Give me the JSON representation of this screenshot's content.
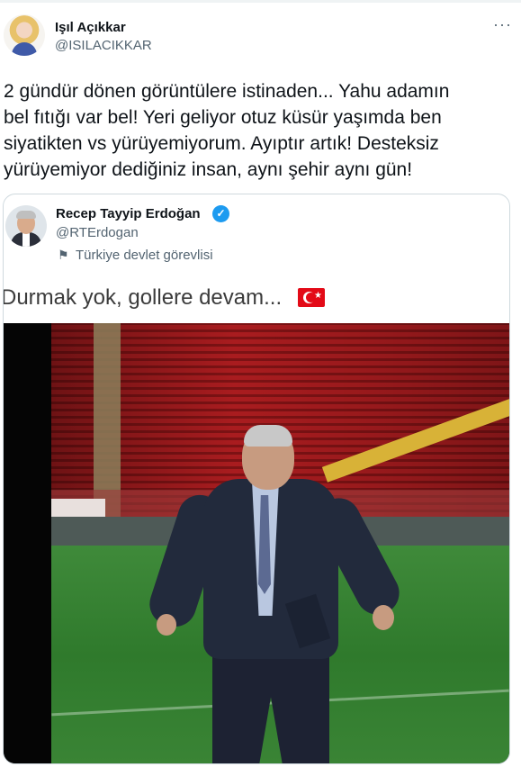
{
  "tweet": {
    "author": {
      "name": "Işıl Açıkkar",
      "handle": "@ISILACIKKAR",
      "avatar_icon": "profile-photo"
    },
    "more_icon": "more-options-icon",
    "more_label": "···",
    "text_lines": [
      "2 gündür dönen görüntülere istinaden... Yahu adamın",
      "bel fıtığı var bel! Yeri geliyor otuz küsür yaşımda ben",
      "siyatikten vs yürüyemiyorum. Ayıptır artık! Desteksiz",
      "yürüyemiyor dediğiniz insan, aynı şehir aynı gün!"
    ]
  },
  "quoted_tweet": {
    "author": {
      "name": "Recep Tayyip Erdoğan",
      "handle": "@RTErdogan",
      "verified": true,
      "verified_icon": "verified-badge-icon",
      "verified_glyph": "✓",
      "label_icon": "flag-icon",
      "label_glyph": "⚑",
      "label": "Türkiye devlet görevlisi"
    },
    "text": "Durmak yok, gollere devam...",
    "emoji": "turkey-flag-emoji",
    "image": "photo-man-kicking-ball-stadium-pitch",
    "colors": {
      "verified_blue": "#1d9bf0",
      "flag_red": "#e30a17",
      "stands_red": "#a91c1f",
      "pitch_green": "#3f8a3a"
    }
  }
}
